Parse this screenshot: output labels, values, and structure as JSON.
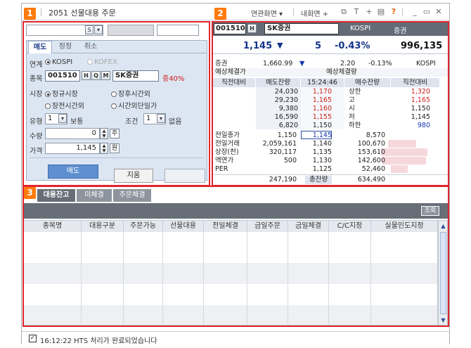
{
  "title": "2051 선물대용 주문",
  "menu": {
    "linked_screen": "연관화면",
    "my_screen": "내화면",
    "icons": [
      "new-window-icon",
      "text-icon",
      "add-icon",
      "print-icon",
      "help-icon",
      "minimize-icon",
      "restore-icon",
      "close-icon"
    ]
  },
  "badges": [
    "1",
    "2",
    "3"
  ],
  "accounts": {
    "combo_button": "S"
  },
  "order": {
    "tabs": [
      "매도",
      "정정",
      "취소"
    ],
    "link_label": "연계",
    "link_options": [
      "KOSPI",
      "KOFEX"
    ],
    "stock_label": "종목",
    "stock_code": "001510",
    "stock_buttons": [
      "H",
      "Q",
      "M"
    ],
    "stock_name": "SK증권",
    "margin_rate": "증40%",
    "market_label": "시장",
    "market_options": [
      "정규시장",
      "장후시간외",
      "장전시간외",
      "시간외단일가"
    ],
    "type_label": "유형",
    "type_value": "1",
    "type_name": "보통",
    "cond_label": "조건",
    "cond_value": "1",
    "cond_name": "없음",
    "qty_label": "수량",
    "qty_value": "0",
    "qty_unit": "주",
    "price_label": "가격",
    "price_value": "1,145",
    "price_unit": "원",
    "sell_button": "매도",
    "reset_button": "지움"
  },
  "quote": {
    "code": "001510",
    "code_buttons": [
      "H",
      "Q",
      "M"
    ],
    "name": "SK증권",
    "market": "KOSPI",
    "sector": "증권",
    "price": "1,145",
    "change_arrow": "▼",
    "change": "5",
    "change_pct": "-0.43%",
    "volume": "996,135",
    "sector_row": {
      "label": "증권",
      "index": "1,660.99",
      "arrow": "▼",
      "chg": "2.20",
      "pct": "-0.13%",
      "market": "KOSPI"
    },
    "expected_row": {
      "label1": "예상체결가",
      "label2": "예상체결량"
    },
    "orderbook_headers": [
      "직전대비",
      "매도잔량",
      "15:24:46",
      "매수잔량",
      "직전대비"
    ],
    "asks": [
      {
        "qty": "24,030",
        "price": "1,170",
        "label": "상한",
        "value": "1,320"
      },
      {
        "qty": "29,230",
        "price": "1,165",
        "label": "고",
        "value": "1,165"
      },
      {
        "qty": "9,380",
        "price": "1,160",
        "label": "시",
        "value": "1,150"
      },
      {
        "qty": "16,590",
        "price": "1,155",
        "label": "저",
        "value": "1,145"
      },
      {
        "qty": "6,820",
        "price": "1,150",
        "label": "하한",
        "value": "980"
      }
    ],
    "bids": [
      {
        "label": "전일종가",
        "lvalue": "1,150",
        "price": "1,145",
        "qty": "8,570"
      },
      {
        "label": "전일거래",
        "lvalue": "2,059,161",
        "price": "1,140",
        "qty": "100,670"
      },
      {
        "label": "상장(천)",
        "lvalue": "320,117",
        "price": "1,135",
        "qty": "153,610"
      },
      {
        "label": "액면가",
        "lvalue": "500",
        "price": "1,130",
        "qty": "142,600"
      },
      {
        "label": "PER",
        "lvalue": "",
        "price": "1,125",
        "qty": "52,460"
      }
    ],
    "totals": {
      "ask_total": "247,190",
      "label": "총잔량",
      "bid_total": "634,490"
    }
  },
  "balance": {
    "tabs": [
      "대용잔고",
      "미체결",
      "주문체결"
    ],
    "query_button": "조회",
    "columns": [
      "종목명",
      "대용구분",
      "주문가능",
      "선물대용",
      "전일체결",
      "금일주문",
      "금일체결",
      "C/C지정",
      "실물인도지정"
    ]
  },
  "status": {
    "check": "✓",
    "message": "16:12:22  HTS 처리가 완료되었습니다"
  }
}
